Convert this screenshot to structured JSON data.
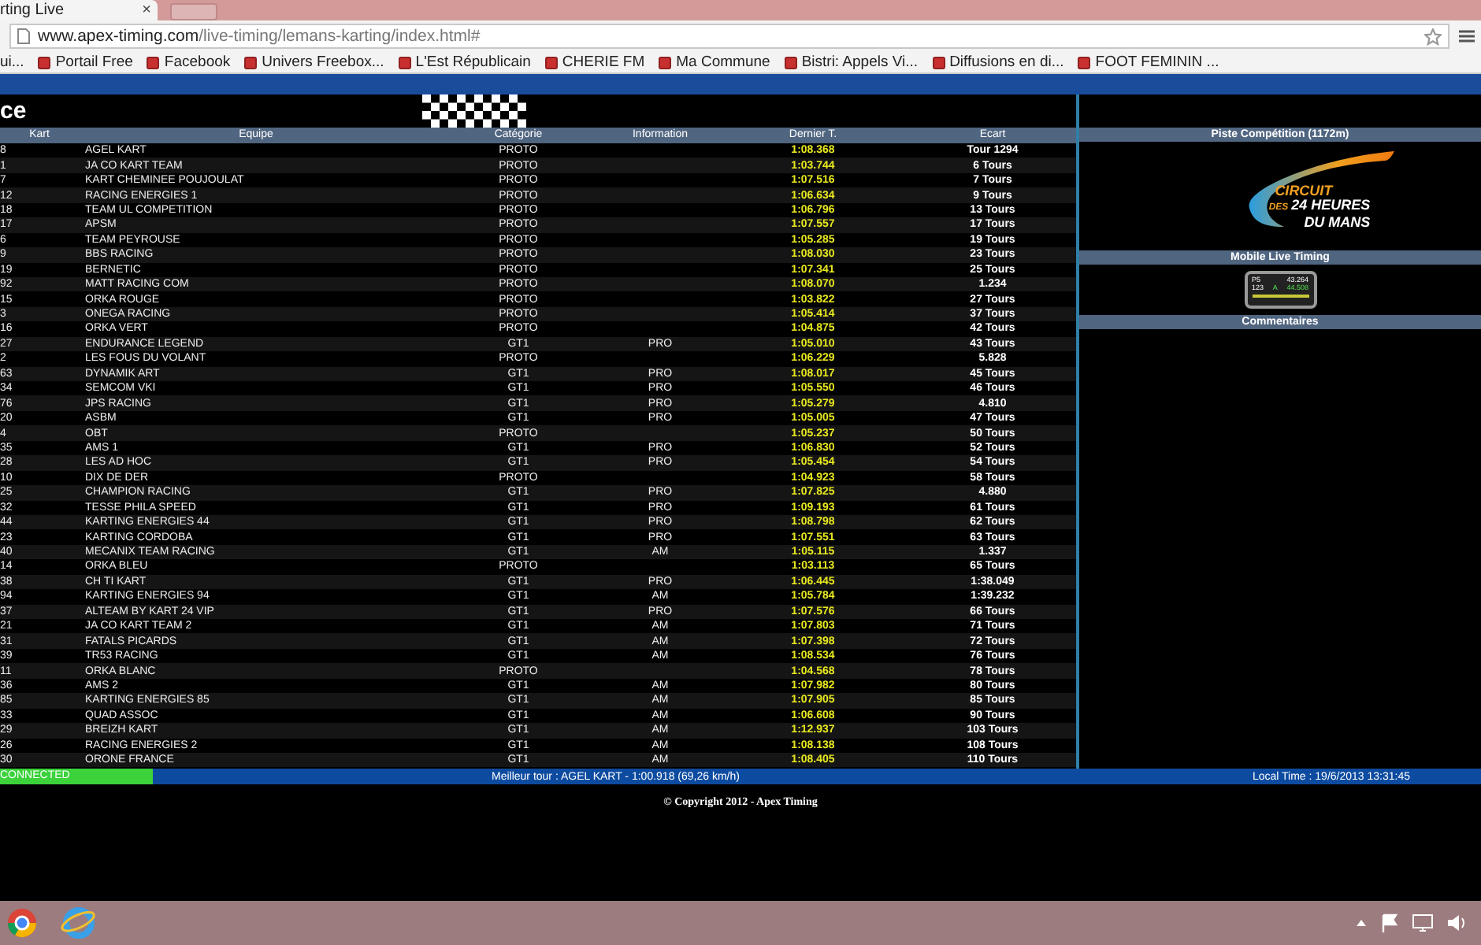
{
  "browser": {
    "tab": {
      "title": "rting Live",
      "close": "×"
    },
    "address": {
      "host": "www.apex-timing.com",
      "path": "/live-timing/lemans-karting/index.html#"
    },
    "bookmarks": [
      {
        "label": "ui..."
      },
      {
        "label": "Portail Free"
      },
      {
        "label": "Facebook"
      },
      {
        "label": "Univers Freebox..."
      },
      {
        "label": "L'Est Républicain"
      },
      {
        "label": "CHERIE FM"
      },
      {
        "label": "Ma Commune"
      },
      {
        "label": "Bistri: Appels Vi..."
      },
      {
        "label": "Diffusions en di..."
      },
      {
        "label": "FOOT FEMININ ..."
      }
    ]
  },
  "page": {
    "title": "ce",
    "table": {
      "columns": [
        "Kart",
        "Equipe",
        "Catégorie",
        "Information",
        "Dernier T.",
        "Ecart"
      ],
      "rows": [
        {
          "kart": "8",
          "team": "AGEL KART",
          "category": "PROTO",
          "last_lap": "1:08.368",
          "gap": "Tour 1294"
        },
        {
          "kart": "1",
          "team": "JA CO KART TEAM",
          "category": "PROTO",
          "last_lap": "1:03.744",
          "gap": "6 Tours"
        },
        {
          "kart": "7",
          "team": "KART CHEMINEE POUJOULAT",
          "category": "PROTO",
          "last_lap": "1:07.516",
          "gap": "7 Tours"
        },
        {
          "kart": "12",
          "team": "RACING ENERGIES 1",
          "category": "PROTO",
          "last_lap": "1:06.634",
          "gap": "9 Tours"
        },
        {
          "kart": "18",
          "team": "TEAM UL COMPETITION",
          "category": "PROTO",
          "last_lap": "1:06.796",
          "gap": "13 Tours"
        },
        {
          "kart": "17",
          "team": "APSM",
          "category": "PROTO",
          "last_lap": "1:07.557",
          "gap": "17 Tours"
        },
        {
          "kart": "6",
          "team": "TEAM PEYROUSE",
          "category": "PROTO",
          "last_lap": "1:05.285",
          "gap": "19 Tours"
        },
        {
          "kart": "9",
          "team": "BBS RACING",
          "category": "PROTO",
          "last_lap": "1:08.030",
          "gap": "23 Tours"
        },
        {
          "kart": "19",
          "team": "BERNETIC",
          "category": "PROTO",
          "last_lap": "1:07.341",
          "gap": "25 Tours"
        },
        {
          "kart": "92",
          "team": "MATT RACING COM",
          "category": "PROTO",
          "last_lap": "1:08.070",
          "gap": "1.234"
        },
        {
          "kart": "15",
          "team": "ORKA ROUGE",
          "category": "PROTO",
          "last_lap": "1:03.822",
          "gap": "27 Tours"
        },
        {
          "kart": "3",
          "team": "ONEGA RACING",
          "category": "PROTO",
          "last_lap": "1:05.414",
          "gap": "37 Tours"
        },
        {
          "kart": "16",
          "team": "ORKA VERT",
          "category": "PROTO",
          "last_lap": "1:04.875",
          "gap": "42 Tours"
        },
        {
          "kart": "27",
          "team": "ENDURANCE LEGEND",
          "category": "GT1",
          "info": "PRO",
          "last_lap": "1:05.010",
          "gap": "43 Tours"
        },
        {
          "kart": "2",
          "team": "LES FOUS DU VOLANT",
          "category": "PROTO",
          "last_lap": "1:06.229",
          "gap": "5.828"
        },
        {
          "kart": "63",
          "team": "DYNAMIK ART",
          "category": "GT1",
          "info": "PRO",
          "last_lap": "1:08.017",
          "gap": "45 Tours"
        },
        {
          "kart": "34",
          "team": "SEMCOM VKI",
          "category": "GT1",
          "info": "PRO",
          "last_lap": "1:05.550",
          "gap": "46 Tours"
        },
        {
          "kart": "76",
          "team": "JPS RACING",
          "category": "GT1",
          "info": "PRO",
          "last_lap": "1:05.279",
          "gap": "4.810"
        },
        {
          "kart": "20",
          "team": "ASBM",
          "category": "GT1",
          "info": "PRO",
          "last_lap": "1:05.005",
          "gap": "47 Tours"
        },
        {
          "kart": "4",
          "team": "OBT",
          "category": "PROTO",
          "last_lap": "1:05.237",
          "gap": "50 Tours"
        },
        {
          "kart": "35",
          "team": "AMS 1",
          "category": "GT1",
          "info": "PRO",
          "last_lap": "1:06.830",
          "gap": "52 Tours"
        },
        {
          "kart": "28",
          "team": "LES AD HOC",
          "category": "GT1",
          "info": "PRO",
          "last_lap": "1:05.454",
          "gap": "54 Tours"
        },
        {
          "kart": "10",
          "team": "DIX DE DER",
          "category": "PROTO",
          "last_lap": "1:04.923",
          "gap": "58 Tours"
        },
        {
          "kart": "25",
          "team": "CHAMPION RACING",
          "category": "GT1",
          "info": "PRO",
          "last_lap": "1:07.825",
          "gap": "4.880"
        },
        {
          "kart": "32",
          "team": "TESSE PHILA SPEED",
          "category": "GT1",
          "info": "PRO",
          "last_lap": "1:09.193",
          "gap": "61 Tours"
        },
        {
          "kart": "44",
          "team": "KARTING ENERGIES 44",
          "category": "GT1",
          "info": "PRO",
          "last_lap": "1:08.798",
          "gap": "62 Tours"
        },
        {
          "kart": "23",
          "team": "KARTING CORDOBA",
          "category": "GT1",
          "info": "PRO",
          "last_lap": "1:07.551",
          "gap": "63 Tours"
        },
        {
          "kart": "40",
          "team": "MECANIX TEAM RACING",
          "category": "GT1",
          "info": "AM",
          "last_lap": "1:05.115",
          "gap": "1.337"
        },
        {
          "kart": "14",
          "team": "ORKA BLEU",
          "category": "PROTO",
          "last_lap": "1:03.113",
          "gap": "65 Tours"
        },
        {
          "kart": "38",
          "team": "CH TI KART",
          "category": "GT1",
          "info": "PRO",
          "last_lap": "1:06.445",
          "gap": "1:38.049"
        },
        {
          "kart": "94",
          "team": "KARTING ENERGIES 94",
          "category": "GT1",
          "info": "AM",
          "last_lap": "1:05.784",
          "gap": "1:39.232"
        },
        {
          "kart": "37",
          "team": "ALTEAM BY KART 24 VIP",
          "category": "GT1",
          "info": "PRO",
          "last_lap": "1:07.576",
          "gap": "66 Tours"
        },
        {
          "kart": "21",
          "team": "JA CO KART TEAM 2",
          "category": "GT1",
          "info": "AM",
          "last_lap": "1:07.803",
          "gap": "71 Tours"
        },
        {
          "kart": "31",
          "team": "FATALS PICARDS",
          "category": "GT1",
          "info": "AM",
          "last_lap": "1:07.398",
          "gap": "72 Tours"
        },
        {
          "kart": "39",
          "team": "TR53 RACING",
          "category": "GT1",
          "info": "AM",
          "last_lap": "1:08.534",
          "gap": "76 Tours"
        },
        {
          "kart": "11",
          "team": "ORKA BLANC",
          "category": "PROTO",
          "last_lap": "1:04.568",
          "gap": "78 Tours"
        },
        {
          "kart": "36",
          "team": "AMS 2",
          "category": "GT1",
          "info": "AM",
          "last_lap": "1:07.982",
          "gap": "80 Tours"
        },
        {
          "kart": "85",
          "team": "KARTING ENERGIES 85",
          "category": "GT1",
          "info": "AM",
          "last_lap": "1:07.905",
          "gap": "85 Tours"
        },
        {
          "kart": "33",
          "team": "QUAD ASSOC",
          "category": "GT1",
          "info": "AM",
          "last_lap": "1:06.608",
          "gap": "90 Tours"
        },
        {
          "kart": "29",
          "team": "BREIZH KART",
          "category": "GT1",
          "info": "AM",
          "last_lap": "1:12.937",
          "gap": "103 Tours"
        },
        {
          "kart": "26",
          "team": "RACING ENERGIES 2",
          "category": "GT1",
          "info": "AM",
          "last_lap": "1:08.138",
          "gap": "108 Tours"
        },
        {
          "kart": "30",
          "team": "ORONE FRANCE",
          "category": "GT1",
          "info": "AM",
          "last_lap": "1:08.405",
          "gap": "110 Tours"
        }
      ]
    },
    "side": {
      "track_title": "Piste Compétition (1172m)",
      "logo": {
        "line_1": "CIRCUIT",
        "line_2_small": "DES",
        "line_2": "24 HEURES",
        "line_3": "DU MANS"
      },
      "mobile_title": "Mobile Live Timing",
      "phone": {
        "row_1": [
          "P5",
          "43.264"
        ],
        "row_2": [
          "123",
          "A",
          "44.508"
        ]
      },
      "comments_title": "Commentaires"
    },
    "status_bar": {
      "connection": "CONNECTED",
      "best_lap": "Meilleur tour : AGEL KART - 1:00.918 (69,26 km/h)",
      "local_time": "Local Time : 19/6/2013 13:31:45"
    },
    "copyright": "© Copyright 2012 - Apex Timing"
  }
}
